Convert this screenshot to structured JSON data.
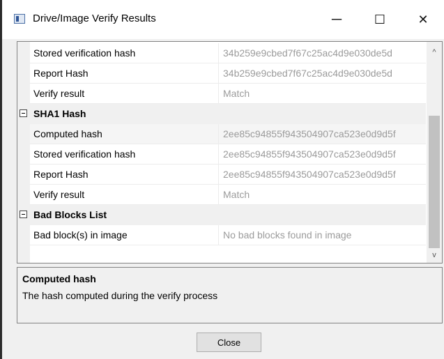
{
  "window": {
    "title": "Drive/Image Verify Results",
    "icon": "app-window-icon",
    "minimize": "─",
    "maximize": "☐",
    "close": "✕"
  },
  "grid": {
    "rows": [
      {
        "kind": "prop",
        "name": "Stored verification hash",
        "value": "34b259e9cbed7f67c25ac4d9e030de5d"
      },
      {
        "kind": "prop",
        "name": "Report Hash",
        "value": "34b259e9cbed7f67c25ac4d9e030de5d"
      },
      {
        "kind": "prop",
        "name": "Verify result",
        "value": "Match"
      },
      {
        "kind": "category",
        "name": "SHA1 Hash"
      },
      {
        "kind": "prop",
        "name": "Computed hash",
        "value": "2ee85c94855f943504907ca523e0d9d5f",
        "alt": true
      },
      {
        "kind": "prop",
        "name": "Stored verification hash",
        "value": "2ee85c94855f943504907ca523e0d9d5f"
      },
      {
        "kind": "prop",
        "name": "Report Hash",
        "value": "2ee85c94855f943504907ca523e0d9d5f"
      },
      {
        "kind": "prop",
        "name": "Verify result",
        "value": "Match"
      },
      {
        "kind": "category",
        "name": "Bad Blocks List"
      },
      {
        "kind": "prop",
        "name": "Bad block(s) in image",
        "value": "No bad blocks found in image"
      }
    ]
  },
  "scrollbar": {
    "up": "^",
    "down": "v"
  },
  "help": {
    "title": "Computed hash",
    "description": "The hash computed during the verify process"
  },
  "close_button": {
    "label": "Close"
  }
}
